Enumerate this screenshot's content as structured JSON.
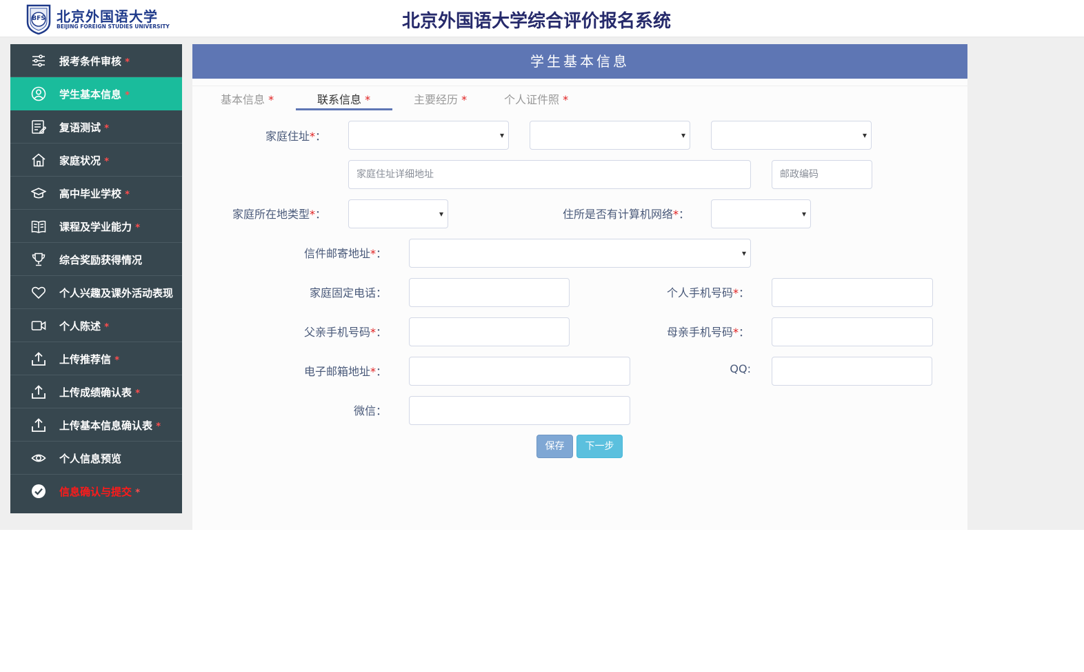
{
  "header": {
    "logo_cn": "北京外国语大学",
    "logo_en": "BEIJING FOREIGN STUDIES UNIVERSITY",
    "logo_badge": "BFS",
    "title": "北京外国语大学综合评价报名系统"
  },
  "sidebar": {
    "items": [
      {
        "label": "报考条件审核",
        "required": "*",
        "icon": "sliders-icon"
      },
      {
        "label": "学生基本信息",
        "required": "*",
        "icon": "user-circle-icon",
        "active": true
      },
      {
        "label": "复语测试",
        "required": "*",
        "icon": "edit-document-icon"
      },
      {
        "label": "家庭状况",
        "required": "*",
        "icon": "home-icon"
      },
      {
        "label": "高中毕业学校",
        "required": "*",
        "icon": "graduation-cap-icon"
      },
      {
        "label": "课程及学业能力",
        "required": "*",
        "icon": "book-icon"
      },
      {
        "label": "综合奖励获得情况",
        "required": "",
        "icon": "trophy-icon"
      },
      {
        "label": "个人兴趣及课外活动表现",
        "required": "",
        "icon": "heart-icon"
      },
      {
        "label": "个人陈述",
        "required": "*",
        "icon": "video-icon"
      },
      {
        "label": "上传推荐信",
        "required": "*",
        "icon": "upload-icon"
      },
      {
        "label": "上传成绩确认表",
        "required": "*",
        "icon": "upload-icon"
      },
      {
        "label": "上传基本信息确认表",
        "required": "*",
        "icon": "upload-icon"
      },
      {
        "label": "个人信息预览",
        "required": "",
        "icon": "eye-icon"
      },
      {
        "label": "信息确认与提交",
        "required": "*",
        "icon": "check-circle-icon",
        "danger": true
      }
    ]
  },
  "panel": {
    "title": "学生基本信息"
  },
  "tabs": [
    {
      "label": "基本信息",
      "star": "*"
    },
    {
      "label": "联系信息",
      "star": "*",
      "active": true
    },
    {
      "label": "主要经历",
      "star": "*"
    },
    {
      "label": "个人证件照",
      "star": "*"
    }
  ],
  "form": {
    "home_address": {
      "label": "家庭住址",
      "star": "*",
      "colon": "："
    },
    "address_detail": {
      "placeholder": "家庭住址详细地址"
    },
    "postcode": {
      "placeholder": "邮政编码"
    },
    "area_type": {
      "label": "家庭所在地类型",
      "star": "*",
      "colon": "："
    },
    "internet": {
      "label": "住所是否有计算机网络",
      "star": "*",
      "colon": "："
    },
    "mail_address": {
      "label": "信件邮寄地址",
      "star": "*",
      "colon": "："
    },
    "home_phone": {
      "label": "家庭固定电话",
      "colon": "："
    },
    "mobile": {
      "label": "个人手机号码",
      "star": "*",
      "colon": "："
    },
    "father_mobile": {
      "label": "父亲手机号码",
      "star": "*",
      "colon": "："
    },
    "mother_mobile": {
      "label": "母亲手机号码",
      "star": "*",
      "colon": "："
    },
    "email": {
      "label": "电子邮箱地址",
      "star": "*",
      "colon": "："
    },
    "qq": {
      "label": "QQ:"
    },
    "wechat": {
      "label": "微信",
      "colon": "："
    }
  },
  "buttons": {
    "save": "保存",
    "next": "下一步"
  },
  "colors": {
    "sidebar_bg": "#37474f",
    "sidebar_active": "#1abc9c",
    "panel_header": "#5e76b4",
    "save_button": "#7fa7d4",
    "next_button": "#5bc0de",
    "required": "#e02020"
  }
}
